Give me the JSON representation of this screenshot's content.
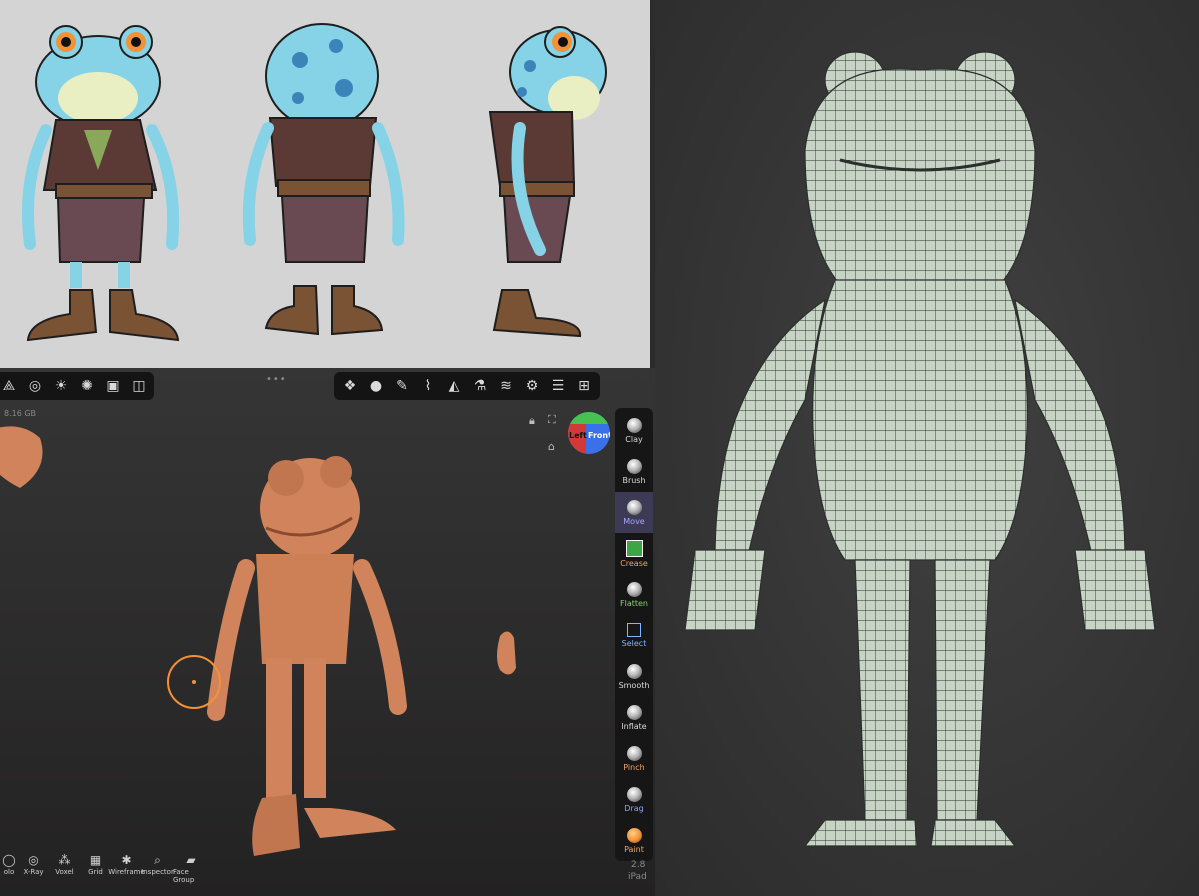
{
  "sculpt_app": {
    "memory_label": "8.16 GB",
    "top_left_toolbar": [
      {
        "icon": "scene-icon",
        "glyph": "⟁"
      },
      {
        "icon": "globe-icon",
        "glyph": "◎"
      },
      {
        "icon": "sun-icon",
        "glyph": "☀"
      },
      {
        "icon": "aperture-icon",
        "glyph": "✺"
      },
      {
        "icon": "image-icon",
        "glyph": "▣"
      },
      {
        "icon": "camera-icon",
        "glyph": "◫"
      }
    ],
    "top_right_toolbar": [
      {
        "icon": "stamp-icon",
        "glyph": "❖"
      },
      {
        "icon": "material-sphere-icon",
        "glyph": "●"
      },
      {
        "icon": "pen-icon",
        "glyph": "✎"
      },
      {
        "icon": "brush-icon",
        "glyph": "⌇"
      },
      {
        "icon": "symmetry-icon",
        "glyph": "◭"
      },
      {
        "icon": "flask-icon",
        "glyph": "⚗"
      },
      {
        "icon": "layers-icon",
        "glyph": "≋"
      },
      {
        "icon": "settings-icon",
        "glyph": "⚙"
      },
      {
        "icon": "sliders-icon",
        "glyph": "☰"
      },
      {
        "icon": "tools-grid-icon",
        "glyph": "⊞"
      }
    ],
    "orientation_cube": {
      "left_face": "Left",
      "front_face": "Front"
    },
    "tools": [
      {
        "label": "Clay",
        "color": "#d8d8d8"
      },
      {
        "label": "Brush",
        "color": "#d8d8d8"
      },
      {
        "label": "Move",
        "color": "#a9a7ff",
        "active": true
      },
      {
        "label": "Crease",
        "color": "#f0a36a"
      },
      {
        "label": "Flatten",
        "color": "#7bdc62"
      },
      {
        "label": "Select",
        "color": "#7fb4ff"
      },
      {
        "label": "Smooth",
        "color": "#d8d8d8"
      },
      {
        "label": "Inflate",
        "color": "#d8d8d8"
      },
      {
        "label": "Pinch",
        "color": "#f0a36a"
      },
      {
        "label": "Drag",
        "color": "#8fa2ff"
      },
      {
        "label": "Paint",
        "color": "#f0a36a"
      }
    ],
    "bottom_bar": [
      {
        "label": "olo",
        "glyph": "◯",
        "icon": "solo-icon"
      },
      {
        "label": "X-Ray",
        "glyph": "◎",
        "icon": "xray-icon"
      },
      {
        "label": "Voxel",
        "glyph": "⁂",
        "icon": "voxel-icon"
      },
      {
        "label": "Grid",
        "glyph": "▦",
        "icon": "grid-icon"
      },
      {
        "label": "Wireframe",
        "glyph": "✱",
        "icon": "wireframe-icon"
      },
      {
        "label": "Inspector",
        "glyph": "⌕",
        "icon": "inspector-icon"
      },
      {
        "label": "Face Group",
        "glyph": "▰",
        "icon": "face-group-icon"
      }
    ],
    "version": "2.8",
    "device": "iPad",
    "accent_color": "#f39137",
    "clay_color": "#d1845c"
  },
  "colors": {
    "frog_skin": "#86d3e8",
    "frog_spots": "#3a84ba",
    "belly": "#e9efc3",
    "vest": "#5b3a35",
    "pants": "#6a4a52",
    "boots": "#7a5234",
    "mesh_fill": "#c7d3c4",
    "mesh_line": "#2a302c"
  }
}
